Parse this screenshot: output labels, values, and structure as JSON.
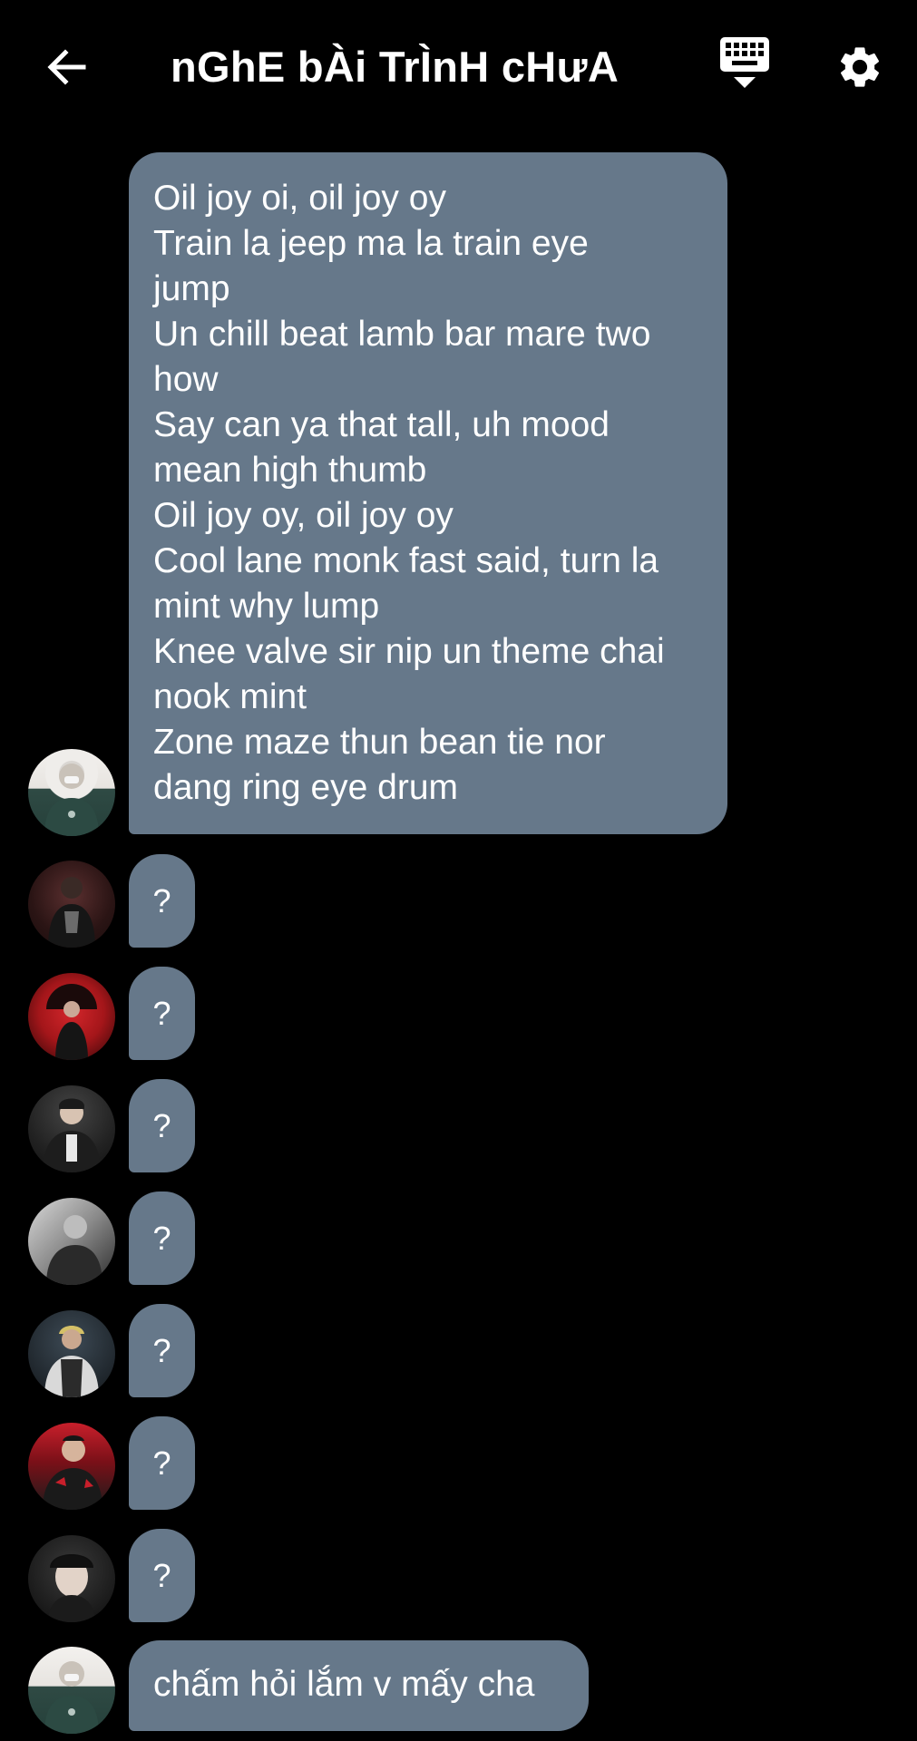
{
  "header": {
    "title": "nGhE bÀi TrÌnH cHưA",
    "back_icon": "arrow-left-icon",
    "keyboard_icon": "keyboard-hide-icon",
    "settings_icon": "gear-icon"
  },
  "colors": {
    "background": "#000000",
    "bubble": "#66788a",
    "text": "#ffffff"
  },
  "messages": [
    {
      "text": "Oil joy oi, oil joy oy\nTrain la jeep ma la train eye\njump\nUn chill beat lamb bar mare two\nhow\nSay can ya that tall, uh mood\nmean high thumb\nOil joy oy, oil joy oy\nCool lane monk fast said, turn la\nmint why lump\nKnee valve sir nip un theme chai\nnook mint\nZone maze thun bean tie nor\ndang ring eye drum"
    },
    {
      "text": "?"
    },
    {
      "text": "?"
    },
    {
      "text": "?"
    },
    {
      "text": "?"
    },
    {
      "text": "?"
    },
    {
      "text": "?"
    },
    {
      "text": "?"
    },
    {
      "text": "chấm hỏi lắm v mấy cha"
    }
  ]
}
